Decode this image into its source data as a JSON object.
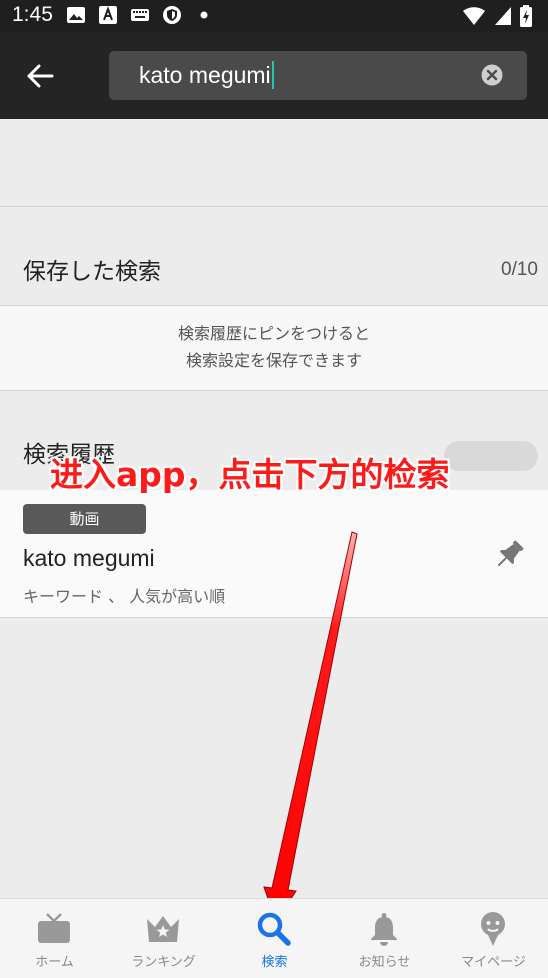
{
  "status_bar": {
    "time": "1:45",
    "icons": [
      "image-icon",
      "text-a-icon",
      "keyboard-icon",
      "shield-icon",
      "dot-icon"
    ],
    "right_icons": [
      "wifi-icon",
      "signal-icon",
      "battery-charging-icon"
    ]
  },
  "search": {
    "query": "kato megumi",
    "clear_icon": "clear-icon",
    "back_icon": "back-arrow-icon"
  },
  "saved_searches": {
    "title": "保存した検索",
    "count": "0/10",
    "hint_line1": "検索履歴にピンをつけると",
    "hint_line2": "検索設定を保存できます"
  },
  "history": {
    "title": "検索履歴",
    "toggle_on": false,
    "items": [
      {
        "badge": "動画",
        "query": "kato megumi",
        "meta": "キーワード 、 人気が高い順",
        "pin_icon": "pin-icon"
      }
    ]
  },
  "annotation": {
    "text": "进入app，点击下方的检索",
    "color": "#ff1a1a"
  },
  "bottom_nav": {
    "items": [
      {
        "label": "ホーム",
        "icon": "tv-icon",
        "active": false
      },
      {
        "label": "ランキング",
        "icon": "crown-icon",
        "active": false
      },
      {
        "label": "検索",
        "icon": "search-icon",
        "active": true
      },
      {
        "label": "お知らせ",
        "icon": "bell-icon",
        "active": false
      },
      {
        "label": "マイページ",
        "icon": "user-icon",
        "active": false
      }
    ],
    "active_color": "#1a73e8"
  }
}
